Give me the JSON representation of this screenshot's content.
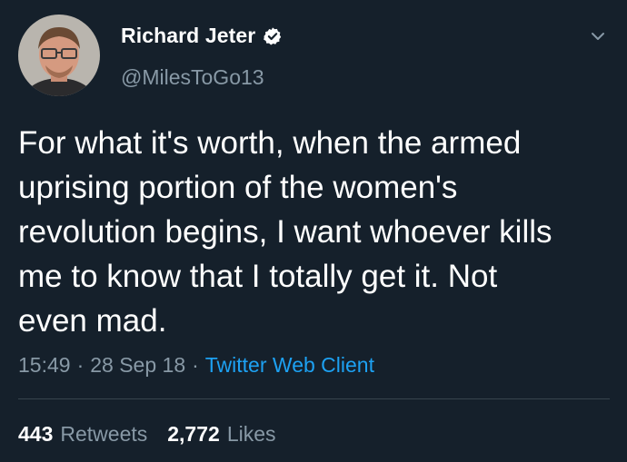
{
  "user": {
    "display_name": "Richard Jeter",
    "handle": "@MilesToGo13",
    "verified": true,
    "verified_icon": "verified-badge-icon",
    "avatar": "profile-photo"
  },
  "tweet": {
    "text": "For what it's worth, when the armed\nuprising portion of the women's\nrevolution begins, I want whoever kills\nme to know that I totally get it. Not\neven mad.",
    "time": "15:49",
    "date": "28 Sep 18",
    "separator": "·",
    "source": "Twitter Web Client"
  },
  "stats": {
    "retweets_count": "443",
    "retweets_label": "Retweets",
    "likes_count": "2,772",
    "likes_label": "Likes"
  },
  "colors": {
    "background": "#15202b",
    "secondary_text": "#8899a6",
    "accent": "#1da1f2",
    "divider": "#38444d"
  }
}
